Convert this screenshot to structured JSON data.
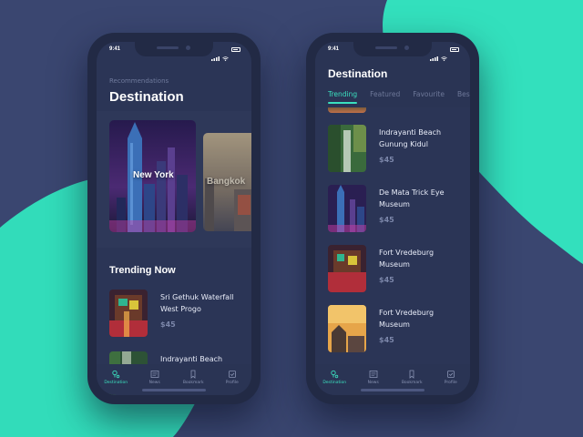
{
  "colors": {
    "background": "#3a4670",
    "accent": "#3be0bf",
    "phone_body": "#222a45",
    "screen": "#2b3556"
  },
  "status_bar": {
    "time": "9:41"
  },
  "left_screen": {
    "subheading": "Recommendations",
    "title": "Destination",
    "carousel": [
      {
        "label": "New York"
      },
      {
        "label": "Bangkok"
      }
    ],
    "section_title": "Trending Now",
    "items": [
      {
        "title": "Sri Gethuk Waterfall West Progo",
        "price": "$45"
      },
      {
        "title": "Indrayanti Beach Gunung Kidul",
        "price": ""
      }
    ]
  },
  "right_screen": {
    "title": "Destination",
    "tabs": [
      "Trending",
      "Featured",
      "Favourite",
      "Bes"
    ],
    "active_tab": "Trending",
    "items": [
      {
        "title": "Indrayanti Beach Gunung Kidul",
        "price": "$45"
      },
      {
        "title": "De Mata Trick Eye Museum",
        "price": "$45"
      },
      {
        "title": "Fort Vredeburg Museum",
        "price": "$45"
      },
      {
        "title": "Fort Vredeburg Museum",
        "price": "$45"
      }
    ]
  },
  "tabbar": {
    "items": [
      {
        "label": "Destination",
        "icon": "pin-icon",
        "active": true
      },
      {
        "label": "News",
        "icon": "news-icon",
        "active": false
      },
      {
        "label": "Bookmark",
        "icon": "bookmark-icon",
        "active": false
      },
      {
        "label": "Profile",
        "icon": "profile-icon",
        "active": false
      }
    ]
  }
}
